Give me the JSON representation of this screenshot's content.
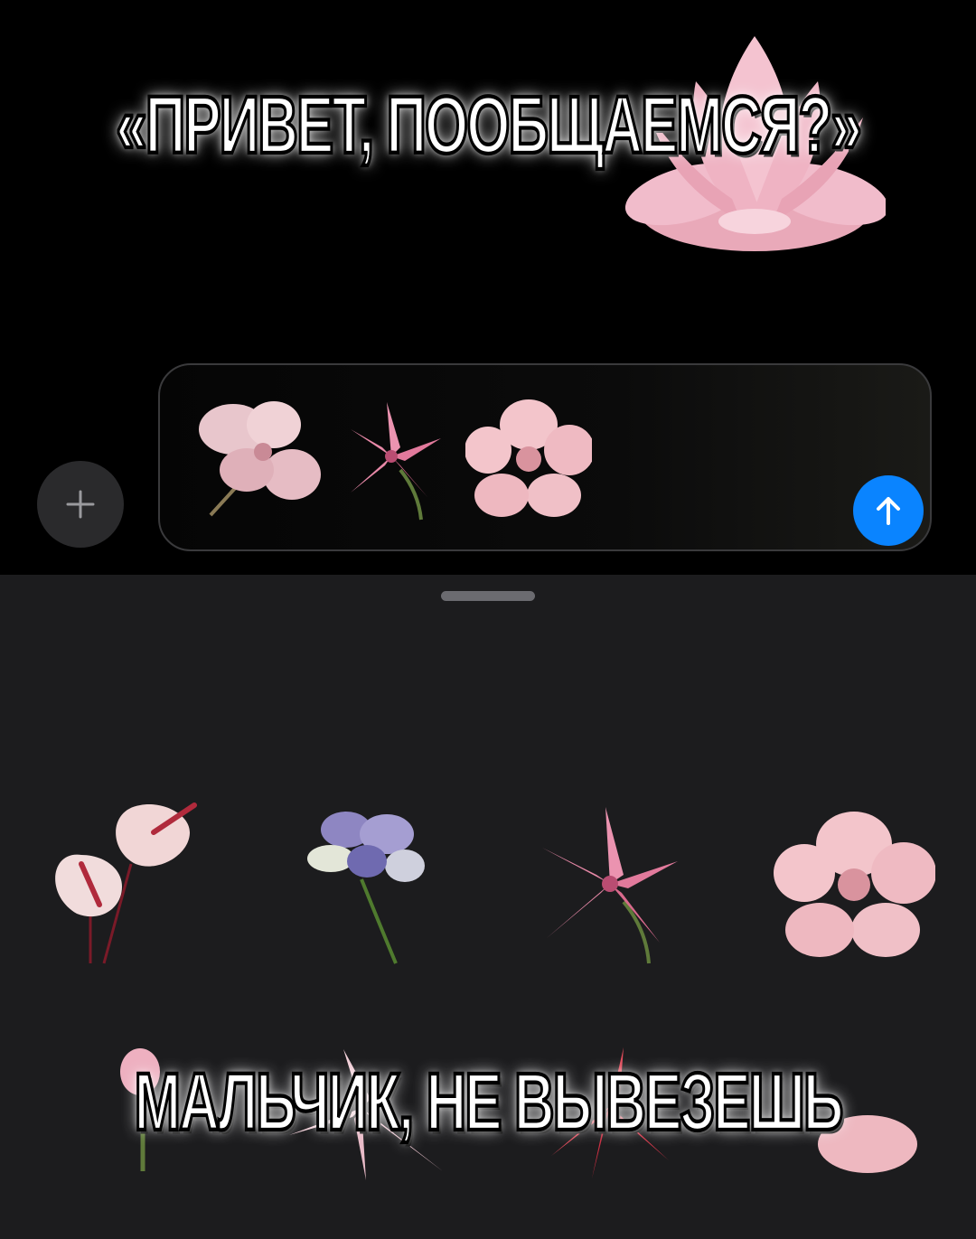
{
  "meme": {
    "top_caption": "«ПРИВЕТ, ПООБЩАЕМСЯ?»",
    "bottom_caption": "МАЛЬЧИК, НЕ ВЫВЕЗЕШЬ"
  },
  "composer": {
    "plus_icon": "plus-icon",
    "send_icon": "arrow-up-icon",
    "attached_stickers": [
      "pink-lily-sticker",
      "stargazer-lily-sticker",
      "pink-hibiscus-sticker"
    ]
  },
  "sticker_sheet": {
    "row1": [
      "anthurium-sticker",
      "lisianthus-sticker",
      "stargazer-lily-sticker",
      "pink-hibiscus-sticker"
    ],
    "row2_partial": [
      "pink-lily-sticker",
      "white-lily-sticker",
      "red-lily-sticker",
      "pink-flower-sticker"
    ]
  },
  "colors": {
    "send_button": "#0a84ff",
    "sheet_background": "#1c1c1e",
    "lotus": "#f2b8c6"
  }
}
